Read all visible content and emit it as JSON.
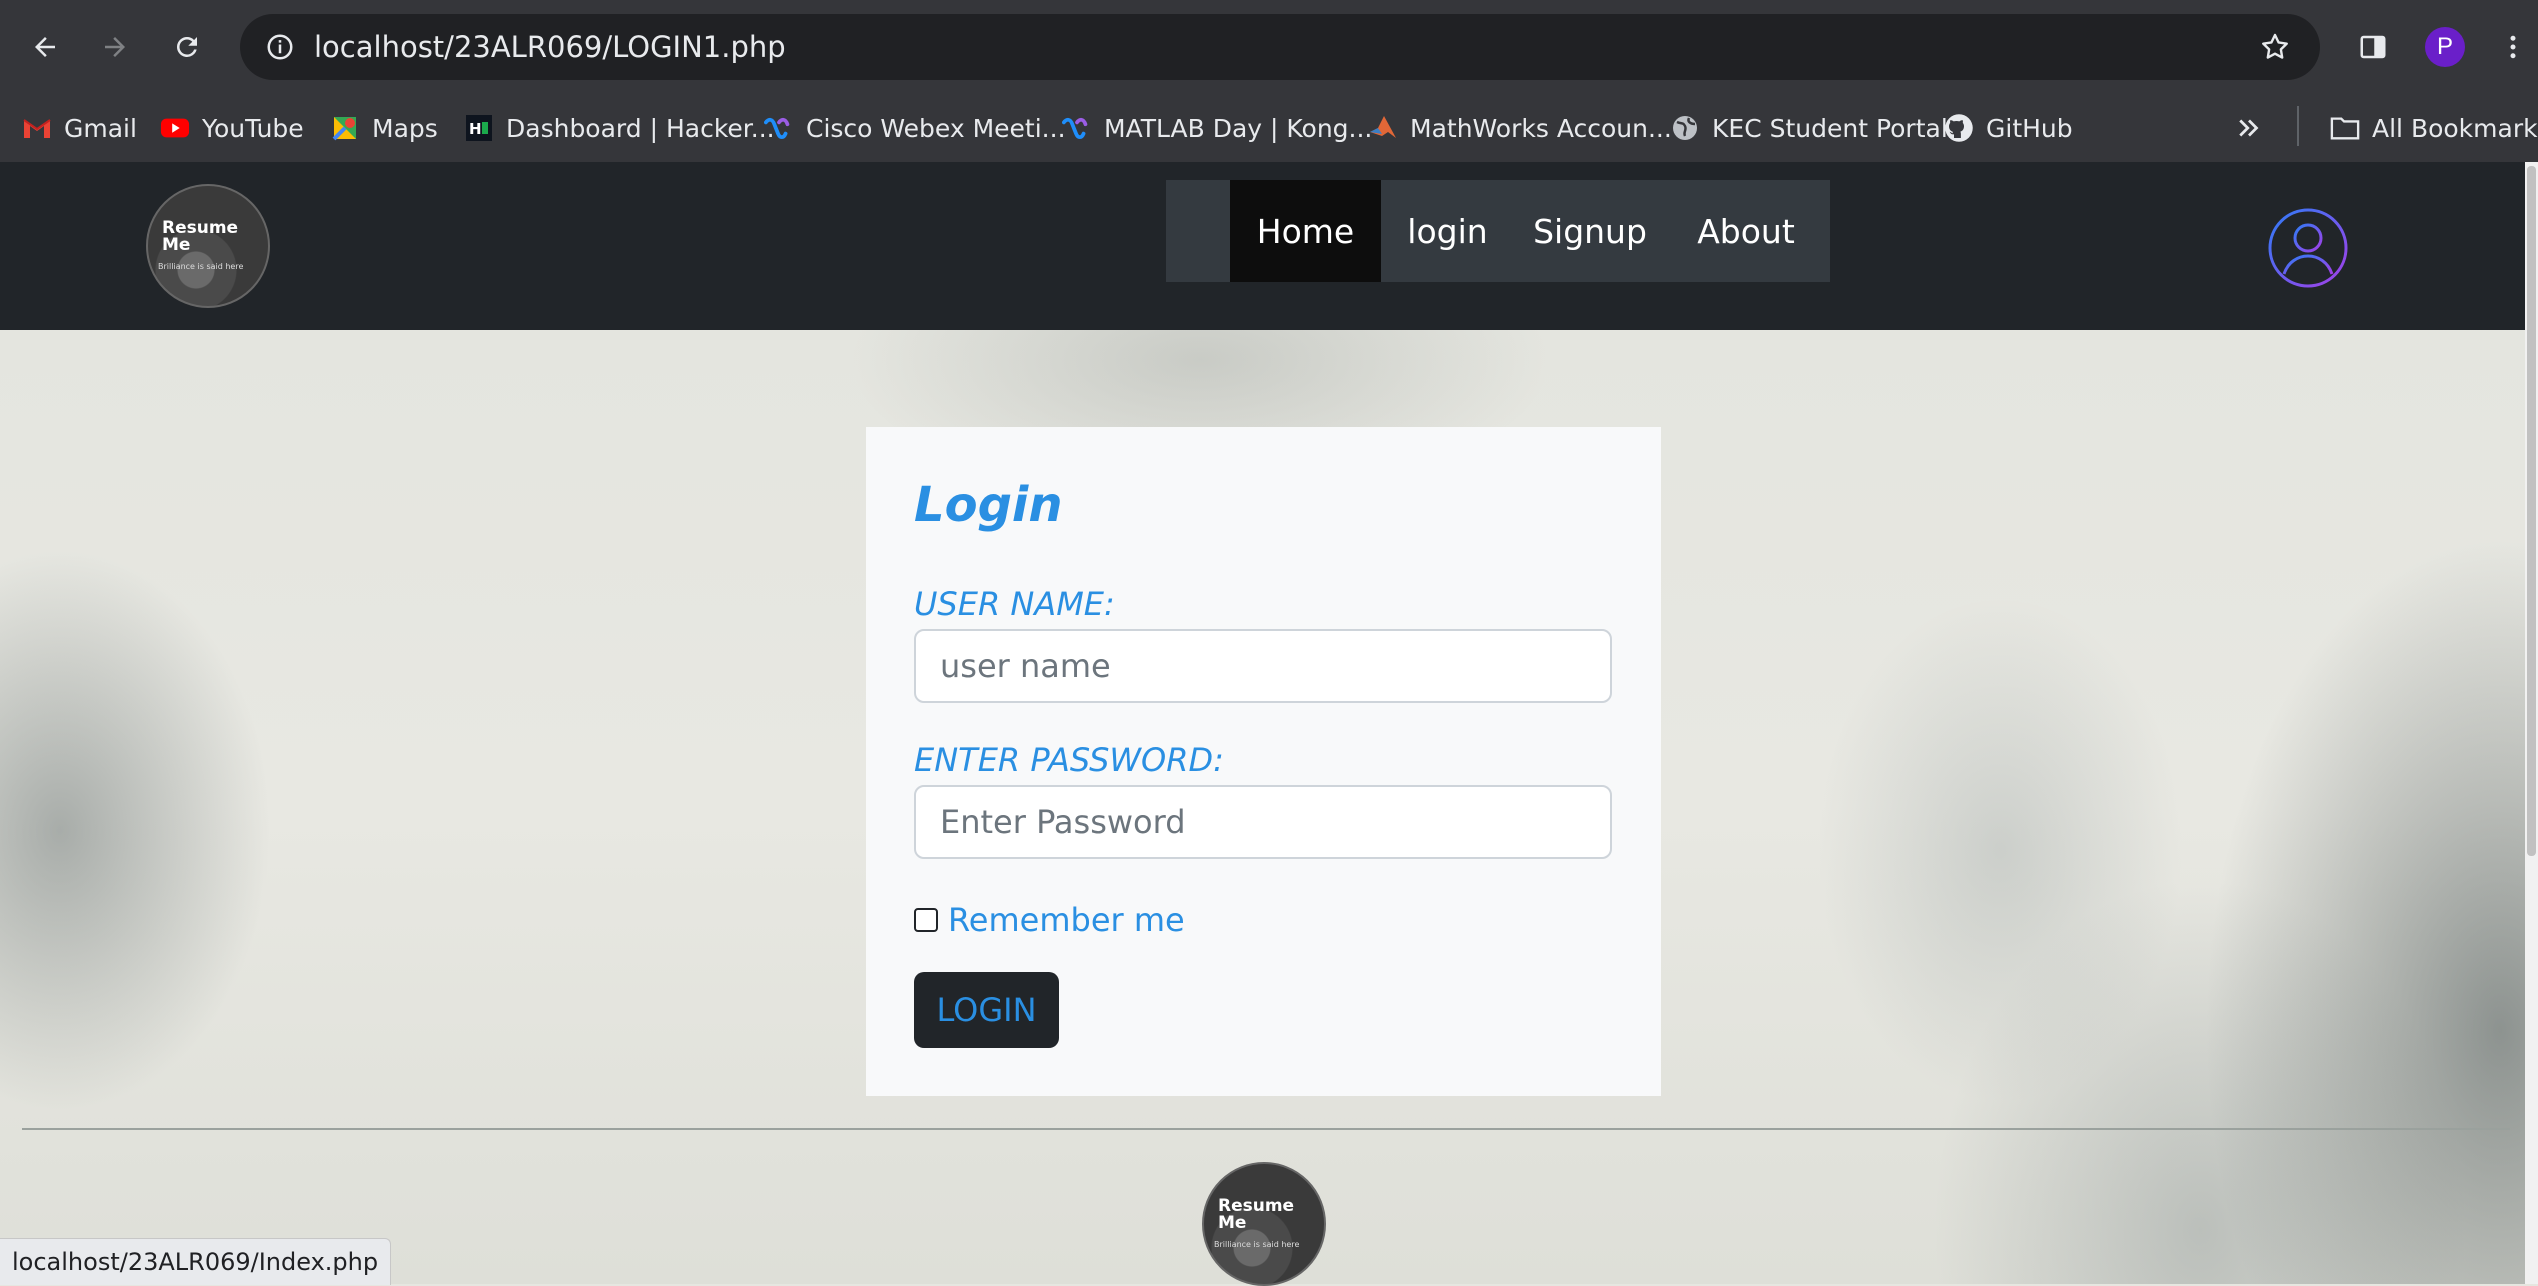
{
  "browser": {
    "url": "localhost/23ALR069/LOGIN1.php",
    "profile_initial": "P",
    "bookmarks": [
      {
        "label": "Gmail",
        "icon": "gmail-icon"
      },
      {
        "label": "YouTube",
        "icon": "youtube-icon"
      },
      {
        "label": "Maps",
        "icon": "maps-icon"
      },
      {
        "label": "Dashboard | Hacker...",
        "icon": "hackerrank-icon"
      },
      {
        "label": "Cisco Webex Meeti...",
        "icon": "webex-icon"
      },
      {
        "label": "MATLAB Day | Kong...",
        "icon": "webex-icon"
      },
      {
        "label": "MathWorks Accoun...",
        "icon": "matlab-icon"
      },
      {
        "label": "KEC Student Portal",
        "icon": "globe-icon"
      },
      {
        "label": "GitHub",
        "icon": "github-icon"
      }
    ],
    "all_bookmarks_label": "All Bookmarks",
    "status_url": "localhost/23ALR069/Index.php"
  },
  "site": {
    "logo_title": "Resume Me",
    "logo_line1": "Resume",
    "logo_line2": "Me",
    "logo_tagline": "Brilliance is said here",
    "nav": [
      {
        "label": "Home",
        "active": true
      },
      {
        "label": "login",
        "active": false
      },
      {
        "label": "Signup",
        "active": false
      },
      {
        "label": "About",
        "active": false
      }
    ]
  },
  "login_form": {
    "title": "Login",
    "username_label": "USER NAME:",
    "username_placeholder": "user name",
    "password_label": "ENTER PASSWORD:",
    "password_placeholder": "Enter Password",
    "remember_label": "Remember me",
    "submit_label": "LOGIN"
  },
  "colors": {
    "accent": "#2a8fe2",
    "header_bg": "#212529",
    "nav_active_bg": "#0d0d0d"
  }
}
